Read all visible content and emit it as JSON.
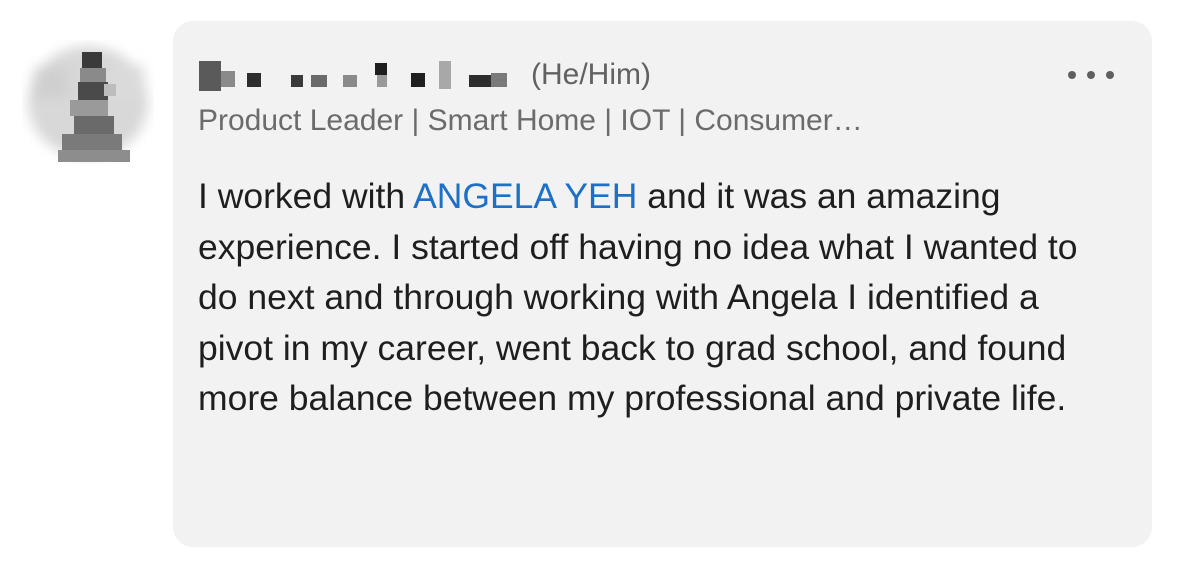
{
  "comment": {
    "author": {
      "pronouns": "(He/Him)",
      "headline": "Product Leader | Smart Home | IOT | Consumer…",
      "name_redacted": true
    },
    "body": {
      "before_mention": "I worked with ",
      "mention": "ANGELA YEH",
      "after_mention": " and it was an amazing experience.  I started off having no idea what I wanted to do next and through working with Angela I identified a pivot in my career, went back to grad school, and found more balance between my professional and private life."
    },
    "more_icon": "more-horizontal-icon"
  },
  "colors": {
    "bubble": "#f2f2f2",
    "mention": "#1e6fc6",
    "text": "#1e1e1e",
    "secondary_text": "#6b6b6b"
  }
}
